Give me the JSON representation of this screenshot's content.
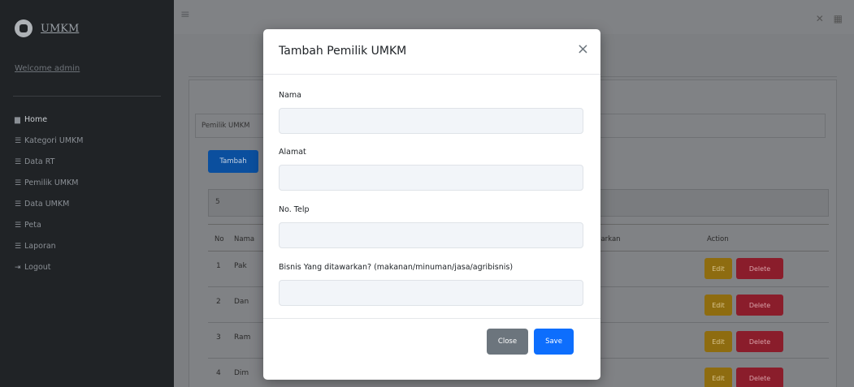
{
  "sidebar": {
    "brand": "UMKM",
    "welcome": "Welcome admin",
    "items": [
      {
        "icon": "home-icon",
        "glyph": "▆",
        "label": "Home"
      },
      {
        "icon": "list-icon",
        "glyph": "☰",
        "label": "Kategori UMKM"
      },
      {
        "icon": "list-icon",
        "glyph": "☰",
        "label": "Data RT"
      },
      {
        "icon": "list-icon",
        "glyph": "☰",
        "label": "Pemilik UMKM"
      },
      {
        "icon": "list-icon",
        "glyph": "☰",
        "label": "Data UMKM"
      },
      {
        "icon": "list-icon",
        "glyph": "☰",
        "label": "Peta"
      },
      {
        "icon": "list-icon",
        "glyph": "☰",
        "label": "Laporan"
      },
      {
        "icon": "logout-icon",
        "glyph": "⇥",
        "label": "Logout"
      }
    ]
  },
  "navbar": {
    "menu_glyph": "≡",
    "right_glyphs": "✕ ▦"
  },
  "card": {
    "title": "Pemilik UMKM",
    "add_button": "Tambah",
    "search_value": "5",
    "columns": {
      "no": "No",
      "name": "Nama",
      "bisnis": "Bisnis Yang ditawarkan",
      "action": "Action"
    },
    "rows": [
      {
        "no": "1",
        "name": "Pak"
      },
      {
        "no": "2",
        "name": "Dan"
      },
      {
        "no": "3",
        "name": "Ram"
      },
      {
        "no": "4",
        "name": "Dim"
      }
    ],
    "edit_label": "Edit",
    "delete_label": "Delete"
  },
  "modal": {
    "title": "Tambah Pemilik UMKM",
    "close_glyph": "×",
    "fields": {
      "nama_label": "Nama",
      "nama_value": "",
      "alamat_label": "Alamat",
      "alamat_value": "",
      "telp_label": "No. Telp",
      "telp_value": "",
      "bisnis_label": "Bisnis Yang ditawarkan? (makanan/minuman/jasa/agribisnis)",
      "bisnis_value": ""
    },
    "close_button": "Close",
    "save_button": "Save"
  },
  "colors": {
    "primary": "#0d6efd",
    "secondary": "#6c757d",
    "warning": "#ffc107",
    "danger": "#dc3545",
    "sidebar": "#212529"
  }
}
